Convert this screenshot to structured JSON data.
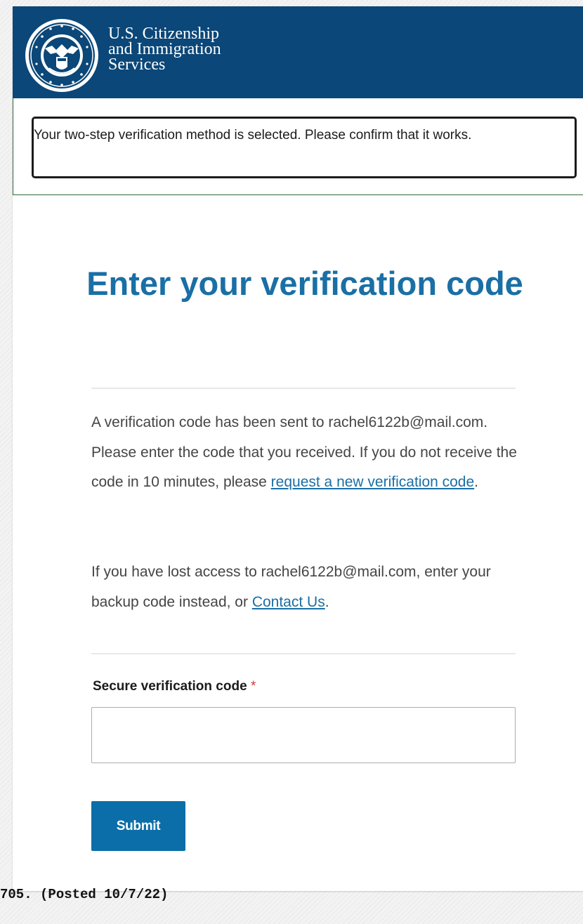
{
  "header": {
    "agency_line1": "U.S. Citizenship",
    "agency_line2": "and Immigration",
    "agency_line3": "Services",
    "seal_icon": "dhs-seal-icon"
  },
  "alert": {
    "message": "Your two-step verification method is selected. Please confirm that it works."
  },
  "main": {
    "title": "Enter your verification code",
    "paragraph1": {
      "text_before": "A verification code has been sent to rachel6122b@mail.com. Please enter the code that you received. If you do not receive the code in 10 minutes, please ",
      "link": "request a new verification code",
      "text_after": "."
    },
    "paragraph2": {
      "text_before": "If you have lost access to rachel6122b@mail.com, enter your backup code instead, or ",
      "link": "Contact Us",
      "text_after": "."
    },
    "field": {
      "label": "Secure verification code",
      "required_marker": "*",
      "value": ""
    },
    "submit_label": "Submit"
  },
  "footnote": "705. (Posted 10/7/22)",
  "colors": {
    "header_bg": "#0b4778",
    "title": "#1a6fa5",
    "link": "#1a6fa5",
    "button_bg": "#0b6ea8",
    "required": "#cc3b3b",
    "alert_border": "#2e6b3a"
  }
}
